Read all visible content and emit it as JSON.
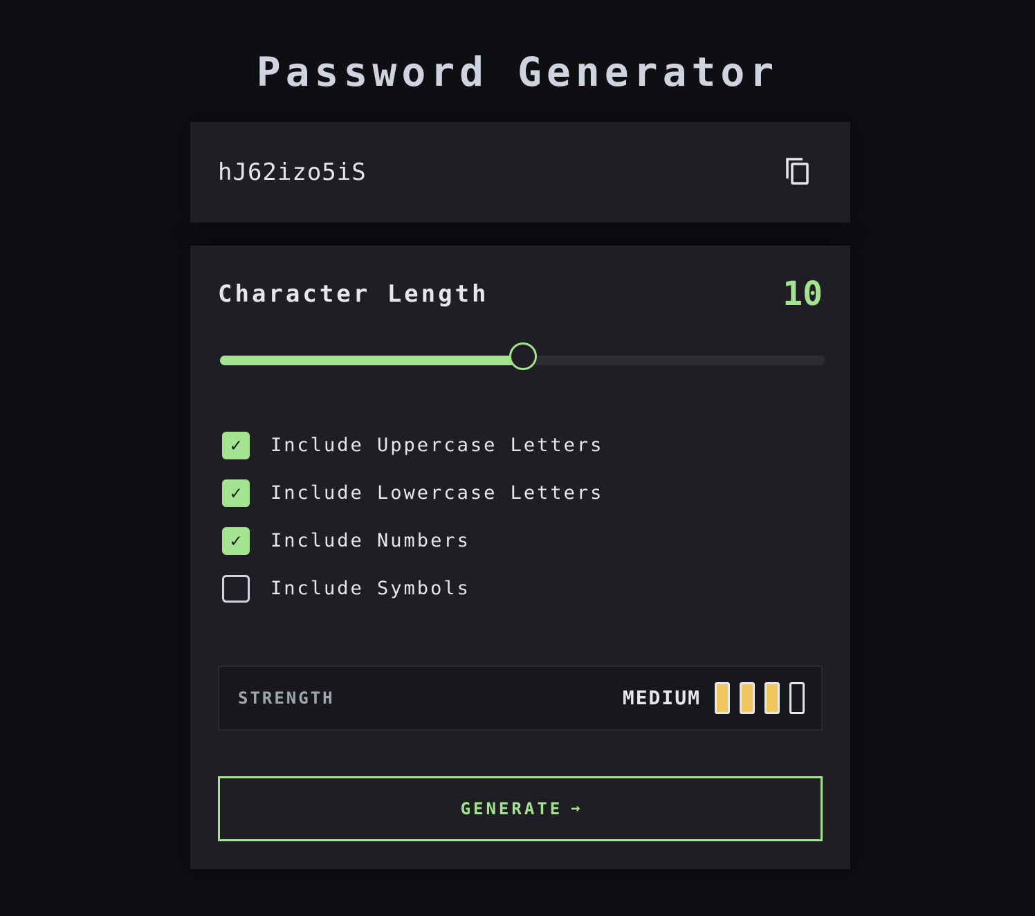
{
  "app": {
    "title": "Password Generator"
  },
  "output": {
    "password": "hJ62izo5iS",
    "copy_icon": "copy-icon"
  },
  "length": {
    "label": "Character Length",
    "value": "10",
    "slider_fraction": 0.5
  },
  "options": [
    {
      "label": "Include Uppercase Letters",
      "checked": true
    },
    {
      "label": "Include Lowercase Letters",
      "checked": true
    },
    {
      "label": "Include Numbers",
      "checked": true
    },
    {
      "label": "Include Symbols",
      "checked": false
    }
  ],
  "strength": {
    "label": "STRENGTH",
    "level": "MEDIUM",
    "bars_filled": 3,
    "bars_total": 4
  },
  "generate": {
    "label": "GENERATE",
    "arrow_icon": "arrow-right-icon"
  },
  "colors": {
    "background": "#0e0e13",
    "card": "#1e1e24",
    "accent_green": "#a4e491",
    "strength_yellow": "#f0c65e",
    "text": "#e6e6ee",
    "muted_text": "#a3a6b0"
  }
}
